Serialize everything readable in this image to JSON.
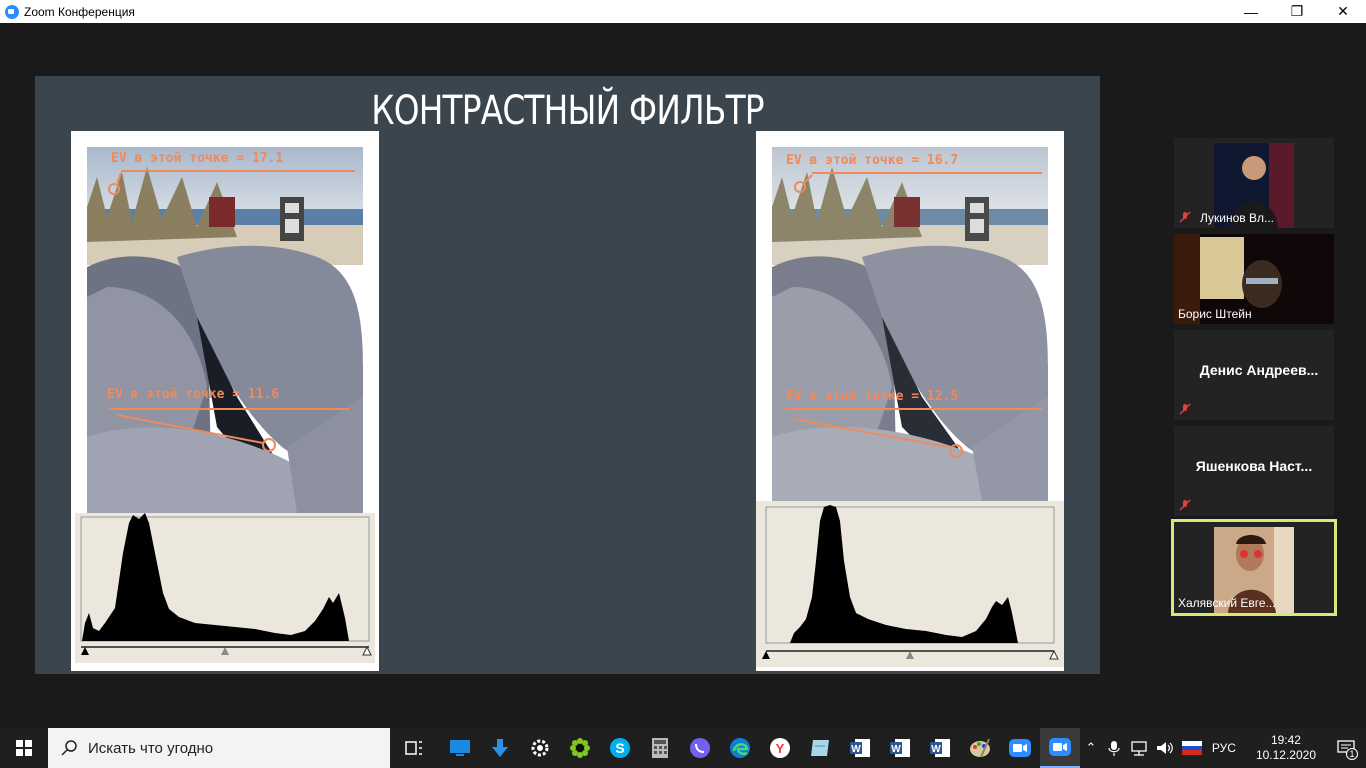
{
  "window": {
    "title": "Zoom Конференция",
    "minimize": "—",
    "restore": "❐",
    "close": "✕"
  },
  "slide": {
    "title": "КОНТРАСТНЫЙ ФИЛЬТР",
    "left": {
      "ev_top": "EV в этой точке = 17.1",
      "ev_bottom": "EV в этой точке = 11.6"
    },
    "right": {
      "ev_top": "EV в этой точке = 16.7",
      "ev_bottom": "EV в этой точке = 12.5"
    }
  },
  "participants": [
    {
      "name": "Лукинов Вл...",
      "muted": true,
      "video": true
    },
    {
      "name": "Борис Штейн",
      "muted": false,
      "video": true
    },
    {
      "name": "Денис  Андреев...",
      "muted": true,
      "video": false
    },
    {
      "name": "Яшенкова  Наст...",
      "muted": true,
      "video": false
    },
    {
      "name": "Халявский Евге...",
      "muted": false,
      "video": true,
      "active_speaker": true
    }
  ],
  "taskbar": {
    "search_placeholder": "Искать что угодно",
    "apps": [
      "task-view-icon",
      "monitor-icon",
      "download-icon",
      "settings-icon",
      "icq-icon",
      "skype-icon",
      "calculator-icon",
      "viber-icon",
      "edge-icon",
      "yandex-icon",
      "notes-icon",
      "word-icon",
      "word-icon",
      "word-icon",
      "paint-icon",
      "zoom-icon",
      "zoom-icon"
    ],
    "language": "РУС",
    "time": "19:42",
    "date": "10.12.2020",
    "notifications": "1"
  },
  "colors": {
    "slide_bg": "#3b454d",
    "ev_text": "#f08a5a",
    "active_border": "#d5e87a",
    "zoom_blue": "#2d8cff"
  }
}
